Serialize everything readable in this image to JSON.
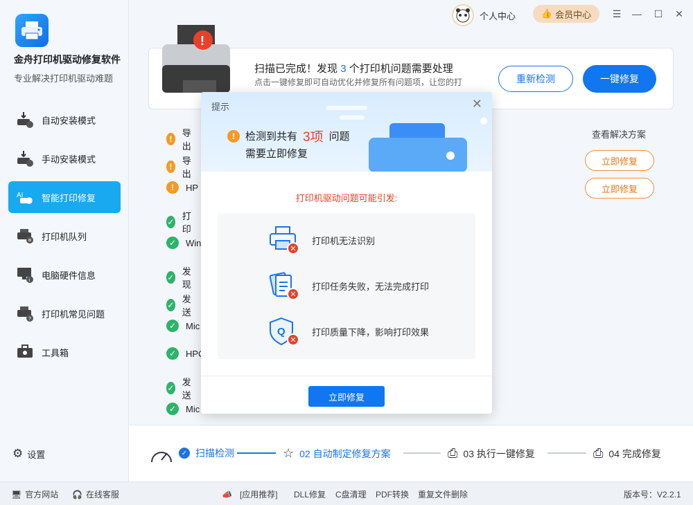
{
  "app": {
    "name": "金舟打印机驱动修复软件",
    "subtitle": "专业解决打印机驱动难题"
  },
  "sidebar": {
    "items": [
      {
        "label": "自动安装模式",
        "icon": "printer-download-icon",
        "active": false
      },
      {
        "label": "手动安装模式",
        "icon": "manual-install-icon",
        "active": false
      },
      {
        "label": "智能打印修复",
        "icon": "ai-repair-icon",
        "active": true
      },
      {
        "label": "打印机队列",
        "icon": "queue-icon",
        "active": false
      },
      {
        "label": "电脑硬件信息",
        "icon": "monitor-info-icon",
        "active": false
      },
      {
        "label": "打印机常见问题",
        "icon": "faq-icon",
        "active": false
      },
      {
        "label": "工具箱",
        "icon": "toolbox-icon",
        "active": false
      }
    ],
    "settings_label": "设置"
  },
  "topbar": {
    "user_center": "个人中心",
    "vip_center": "会员中心"
  },
  "scan": {
    "title_prefix": "扫描已完成！发现",
    "issue_count": "3",
    "title_suffix": "个打印机问题需要处理",
    "description": "点击一键修复即可自动优化并修复所有问题项，让您的打",
    "rescan_label": "重新检测",
    "fix_all_label": "一键修复"
  },
  "results": {
    "solution_header": "查看解决方案",
    "fix_button_label": "立即修复",
    "rows": [
      {
        "text": "导出",
        "status": "warn"
      },
      {
        "text": "导出",
        "status": "warn"
      },
      {
        "text": "HP",
        "status": "warn"
      },
      {
        "text": "打印",
        "status": "ok"
      },
      {
        "text": "Win",
        "status": "ok"
      },
      {
        "text": "发现",
        "status": "ok"
      },
      {
        "text": "发送",
        "status": "ok"
      },
      {
        "text": "Mic",
        "status": "ok"
      },
      {
        "text": "HPC",
        "status": "ok"
      },
      {
        "text": "发送",
        "status": "ok"
      },
      {
        "text": "Mic",
        "status": "ok"
      }
    ]
  },
  "steps": [
    {
      "label": "扫描检测",
      "state": "done"
    },
    {
      "label": "02 自动制定修复方案",
      "state": "current"
    },
    {
      "label": "03 执行一键修复",
      "state": "pending"
    },
    {
      "label": "04 完成修复",
      "state": "pending"
    }
  ],
  "footer": {
    "website": "官方网站",
    "service": "在线客服",
    "recommend": "[应用推荐]",
    "links": [
      "DLL修复",
      "C盘清理",
      "PDF转换",
      "重复文件删除"
    ],
    "version": "版本号：V2.2.1"
  },
  "modal": {
    "title": "提示",
    "alert_prefix": "检测到共有",
    "alert_count": "3项",
    "alert_suffix": "问题",
    "alert_line2": "需要立即修复",
    "subtitle": "打印机驱动问题可能引发:",
    "issues": [
      {
        "text": "打印机无法识别",
        "icon": "printer-error-icon"
      },
      {
        "text": "打印任务失败，无法完成打印",
        "icon": "document-error-icon"
      },
      {
        "text": "打印质量下降，影响打印效果",
        "icon": "quality-error-icon"
      }
    ],
    "fix_now_label": "立即修复"
  },
  "colors": {
    "primary": "#1077f0",
    "accent": "#18a9f0",
    "warning": "#f59a23",
    "success": "#2db36a",
    "danger": "#e8402a"
  }
}
